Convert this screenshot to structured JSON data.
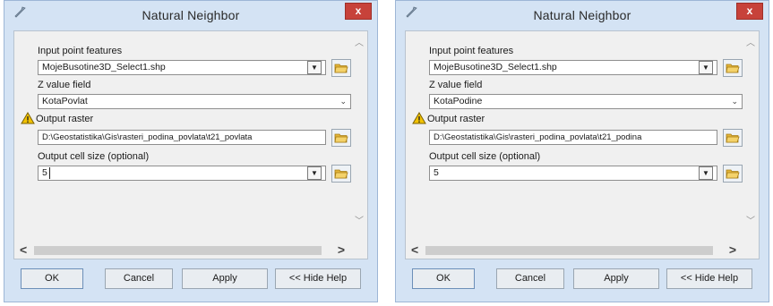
{
  "dialogs": [
    {
      "title": "Natural Neighbor",
      "close": "x",
      "input_point_features_label": "Input point features",
      "input_point_features_value": "MojeBusotine3D_Select1.shp",
      "z_value_field_label": "Z value field",
      "z_value_field_value": "KotaPovlat",
      "output_raster_label": "Output raster",
      "output_raster_value": "D:\\Geostatistika\\Gis\\rasteri_podina_povlata\\t21_povlata",
      "output_cell_size_label": "Output cell size (optional)",
      "output_cell_size_value": "5",
      "buttons": {
        "ok": "OK",
        "cancel": "Cancel",
        "apply": "Apply",
        "help": "<< Hide Help"
      }
    },
    {
      "title": "Natural Neighbor",
      "close": "x",
      "input_point_features_label": "Input point features",
      "input_point_features_value": "MojeBusotine3D_Select1.shp",
      "z_value_field_label": "Z value field",
      "z_value_field_value": "KotaPodine",
      "output_raster_label": "Output raster",
      "output_raster_value": "D:\\Geostatistika\\Gis\\rasteri_podina_povlata\\t21_podina",
      "output_cell_size_label": "Output cell size (optional)",
      "output_cell_size_value": "5",
      "buttons": {
        "ok": "OK",
        "cancel": "Cancel",
        "apply": "Apply",
        "help": "<< Hide Help"
      }
    }
  ],
  "icons": {
    "app": "tool-icon",
    "browse": "folder-open-icon",
    "warning": "warning-icon",
    "dropdown": "chevron-down-icon",
    "scroll_left": "chevron-left-icon",
    "scroll_right": "chevron-right-icon"
  },
  "colors": {
    "title_bar": "#d4e3f4",
    "close_button": "#c7423a",
    "client_bg": "#f0f0f0",
    "warning": "#f2c200"
  }
}
